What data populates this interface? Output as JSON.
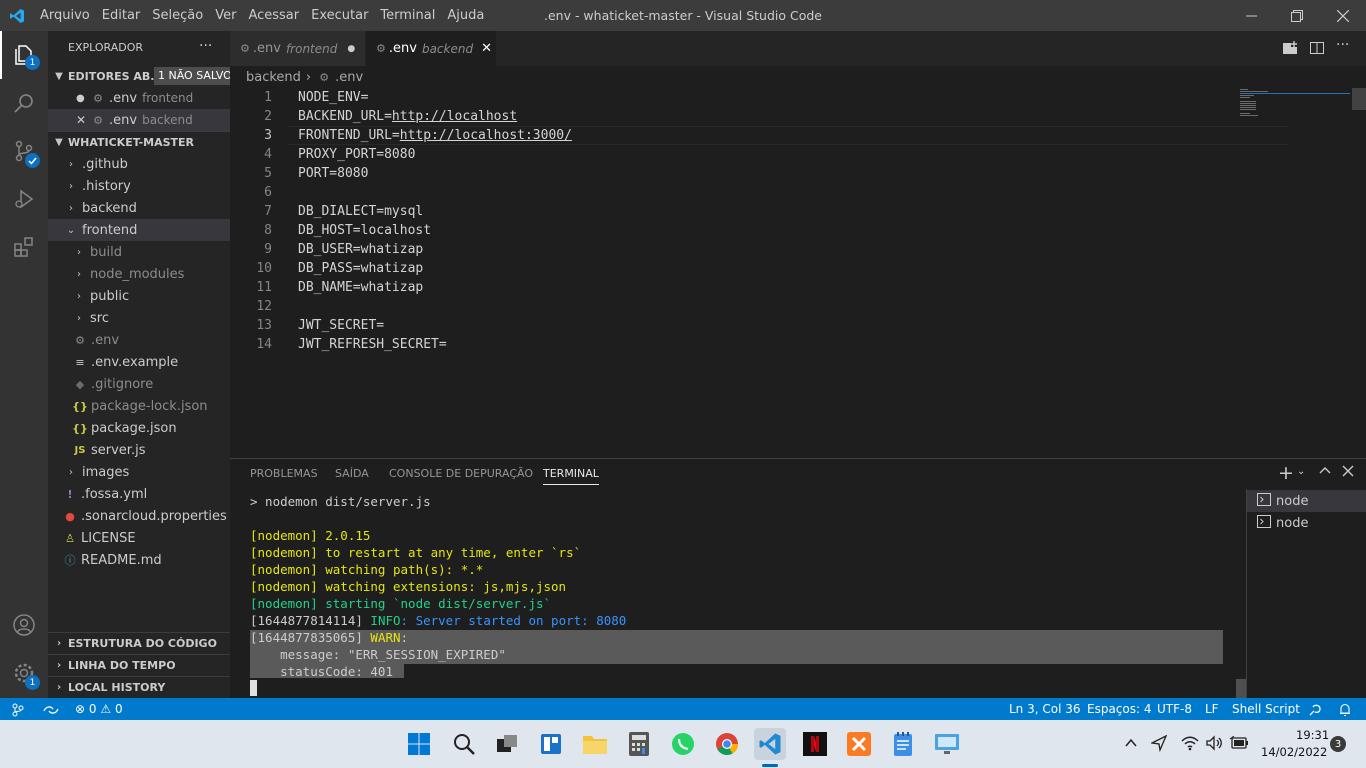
{
  "titlebar": {
    "menu": [
      "Arquivo",
      "Editar",
      "Seleção",
      "Ver",
      "Acessar",
      "Executar",
      "Terminal",
      "Ajuda"
    ],
    "title": ".env - whaticket-master - Visual Studio Code"
  },
  "activity": {
    "explorer_badge": "1",
    "settings_badge": "1"
  },
  "sidebar": {
    "header": "EXPLORADOR",
    "open_editors": {
      "title": "EDITORES AB...",
      "unsaved": "1 NÃO SALVO"
    },
    "open_files": [
      {
        "name": ".env",
        "folder": "frontend"
      },
      {
        "name": ".env",
        "folder": "backend"
      }
    ],
    "root": "WHATICKET-MASTER",
    "tree": {
      "github": ".github",
      "history": ".history",
      "backend": "backend",
      "frontend": "frontend",
      "build": "build",
      "node_modules": "node_modules",
      "public": "public",
      "src": "src",
      "env": ".env",
      "env_example": ".env.example",
      "gitignore": ".gitignore",
      "package_lock": "package-lock.json",
      "package_json": "package.json",
      "server_js": "server.js",
      "images": "images",
      "fossa": ".fossa.yml",
      "sonarcloud": ".sonarcloud.properties",
      "license": "LICENSE",
      "readme": "README.md"
    },
    "sections": {
      "outline": "ESTRUTURA DO CÓDIGO",
      "timeline": "LINHA DO TEMPO",
      "local_history": "LOCAL HISTORY"
    }
  },
  "tabs": [
    {
      "name": ".env",
      "folder": "frontend"
    },
    {
      "name": ".env",
      "folder": "backend"
    }
  ],
  "breadcrumb": {
    "folder": "backend",
    "file": ".env"
  },
  "editor": {
    "lines": [
      {
        "n": "1",
        "key": "NODE_ENV=",
        "url": ""
      },
      {
        "n": "2",
        "key": "BACKEND_URL=",
        "url": "http://localhost"
      },
      {
        "n": "3",
        "key": "FRONTEND_URL=",
        "url": "http://localhost:3000/"
      },
      {
        "n": "4",
        "key": "PROXY_PORT=8080",
        "url": ""
      },
      {
        "n": "5",
        "key": "PORT=8080",
        "url": ""
      },
      {
        "n": "6",
        "key": "",
        "url": ""
      },
      {
        "n": "7",
        "key": "DB_DIALECT=mysql",
        "url": ""
      },
      {
        "n": "8",
        "key": "DB_HOST=localhost",
        "url": ""
      },
      {
        "n": "9",
        "key": "DB_USER=whatizap",
        "url": ""
      },
      {
        "n": "10",
        "key": "DB_PASS=whatizap",
        "url": ""
      },
      {
        "n": "11",
        "key": "DB_NAME=whatizap",
        "url": ""
      },
      {
        "n": "12",
        "key": "",
        "url": ""
      },
      {
        "n": "13",
        "key": "JWT_SECRET=",
        "url": ""
      },
      {
        "n": "14",
        "key": "JWT_REFRESH_SECRET=",
        "url": ""
      }
    ]
  },
  "panel": {
    "tabs": [
      "PROBLEMAS",
      "SAÍDA",
      "CONSOLE DE DEPURAÇÃO",
      "TERMINAL"
    ],
    "terminal": {
      "cmd": "> nodemon dist/server.js",
      "n1": "[nodemon] 2.0.15",
      "n2": "[nodemon] to restart at any time, enter `rs`",
      "n3": "[nodemon] watching path(s): *.*",
      "n4": "[nodemon] watching extensions: js,mjs,json",
      "n5": "[nodemon] starting `node dist/server.js`",
      "info_ts": "[1644877814114] ",
      "info_lvl": "INFO",
      "info_msg": ": Server started on port: 8080",
      "warn_ts": "[1644877835065] ",
      "warn_lvl": "WARN",
      "warn_tail": ":",
      "msg": "    message: \"ERR_SESSION_EXPIRED\"",
      "code": "    statusCode: 401"
    },
    "terminals": [
      "node",
      "node"
    ]
  },
  "statusbar": {
    "errors": "0",
    "warnings": "0",
    "position": "Ln 3, Col 36",
    "spaces": "Espaços: 4",
    "encoding": "UTF-8",
    "eol": "LF",
    "language": "Shell Script"
  },
  "taskbar": {
    "time": "19:31",
    "date": "14/02/2022",
    "notifications": "3"
  }
}
